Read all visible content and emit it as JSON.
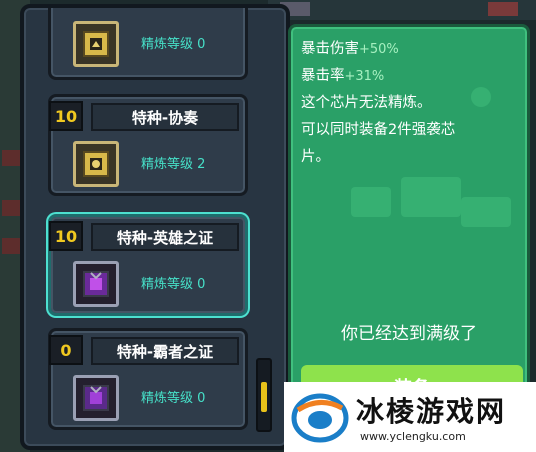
{
  "chip_list": {
    "items": [
      {
        "level": "",
        "name": "",
        "refine": "精炼等级 0",
        "icon": "gold-chip-icon"
      },
      {
        "level": "10",
        "name": "特种-协奏",
        "refine": "精炼等级 2",
        "icon": "gold-chip-icon"
      },
      {
        "level": "10",
        "name": "特种-英雄之证",
        "refine": "精炼等级 0",
        "icon": "purple-chip-icon",
        "selected": true
      },
      {
        "level": "0",
        "name": "特种-霸者之证",
        "refine": "精炼等级 0",
        "icon": "purple-chip-icon"
      }
    ]
  },
  "detail": {
    "crit_damage_label": "暴击伤害",
    "crit_damage_value": "+50%",
    "crit_rate_label": "暴击率",
    "crit_rate_value": "+31%",
    "note_refine": "这个芯片无法精炼。",
    "note_equip_1": "可以同时装备2件强袭芯",
    "note_equip_2": "片。",
    "max_level": "你已经达到满级了",
    "equip_button": "装备"
  },
  "watermark": {
    "title": "冰棱游戏网",
    "url": "www.yclengku.com"
  },
  "colors": {
    "accent_teal": "#46e0c8",
    "level_gold": "#f0c820",
    "panel_green": "#2aa067",
    "button_green": "#8ee24c"
  }
}
